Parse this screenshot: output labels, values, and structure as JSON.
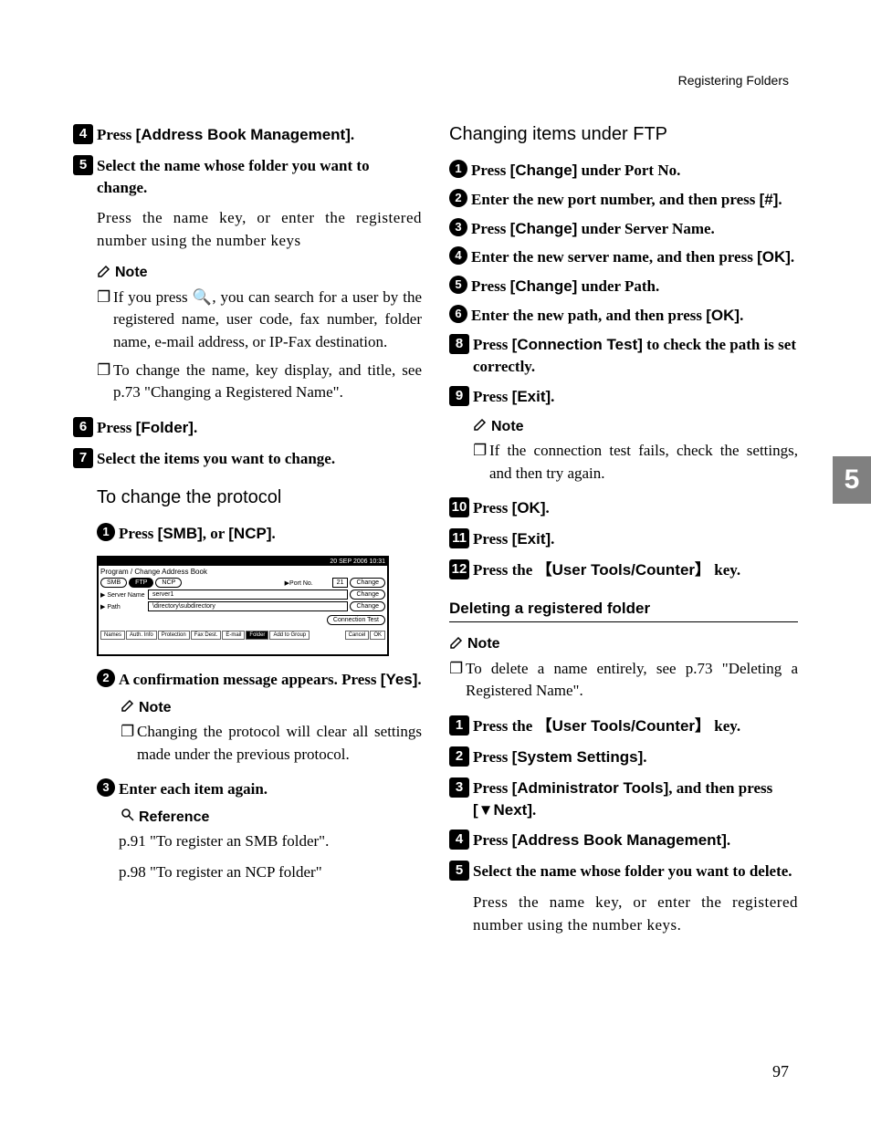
{
  "header": {
    "running_head": "Registering Folders"
  },
  "chapter_tab": "5",
  "page_number": "97",
  "left": {
    "step4": {
      "num": "4",
      "prefix": "Press ",
      "btn": "[Address Book Management]",
      "suffix": "."
    },
    "step5": {
      "num": "5",
      "text": "Select the name whose folder you want to change."
    },
    "step5_desc": "Press the name key, or enter the registered number using the number keys",
    "note_label": "Note",
    "note_items": [
      "If you press 🔍, you can search for a user by the registered name, user code, fax number, folder name, e-mail address, or IP-Fax destination.",
      "To change the name, key display, and title, see p.73 \"Changing a Registered Name\"."
    ],
    "step6": {
      "num": "6",
      "prefix": "Press ",
      "btn": "[Folder]",
      "suffix": "."
    },
    "step7": {
      "num": "7",
      "text": "Select the items you want to change."
    },
    "heading_protocol": "To change the protocol",
    "sub1": {
      "num": "1",
      "prefix": "Press ",
      "btn1": "[SMB]",
      "mid": ", or ",
      "btn2": "[NCP]",
      "suffix": "."
    },
    "screenshot": {
      "title": "Program / Change Address Book",
      "smb": "SMB",
      "ftp": "FTP",
      "ncp": "NCP",
      "portno_label": "▶Port No.",
      "portno_val": "21",
      "change": "Change",
      "server_label": "▶ Server Name",
      "server_val": "server1",
      "path_label": "▶ Path",
      "path_val": "\\directory\\subdirectory",
      "conn_test": "Connection Test",
      "tabs": [
        "Names",
        "Auth. Info",
        "Protection",
        "Fax Dest.",
        "E-mail",
        "Folder",
        "Add to Group"
      ],
      "cancel": "Cancel",
      "ok": "OK"
    },
    "sub2": {
      "num": "2",
      "text_a": "A confirmation message appears. Press ",
      "btn": "[Yes]",
      "suffix": "."
    },
    "sub_note_label": "Note",
    "sub_note_item": "Changing the protocol will clear all settings made under the previous protocol.",
    "sub3": {
      "num": "3",
      "text": "Enter each item again."
    },
    "ref_label": "Reference",
    "ref1": "p.91 \"To register an SMB folder\".",
    "ref2": "p.98 \"To register an NCP folder\""
  },
  "right": {
    "heading_ftp": "Changing items under FTP",
    "f1": {
      "num": "1",
      "prefix": "Press ",
      "btn": "[Change]",
      "suffix": " under Port No."
    },
    "f2": {
      "num": "2",
      "text_a": "Enter the new port number, and then press ",
      "btn": "[#]",
      "suffix": "."
    },
    "f3": {
      "num": "3",
      "prefix": "Press ",
      "btn": "[Change]",
      "suffix": " under Server Name."
    },
    "f4": {
      "num": "4",
      "text_a": "Enter the new server name, and then press ",
      "btn": "[OK]",
      "suffix": "."
    },
    "f5": {
      "num": "5",
      "prefix": "Press ",
      "btn": "[Change]",
      "suffix": " under Path."
    },
    "f6": {
      "num": "6",
      "text_a": "Enter the new path, and then press ",
      "btn": "[OK]",
      "suffix": "."
    },
    "step8": {
      "num": "8",
      "prefix": "Press ",
      "btn": "[Connection Test]",
      "suffix": " to check the path is set correctly."
    },
    "step9": {
      "num": "9",
      "prefix": "Press ",
      "btn": "[Exit]",
      "suffix": "."
    },
    "note9_label": "Note",
    "note9_item": "If the connection test fails, check the settings, and then try again.",
    "step10": {
      "num": "10",
      "prefix": "Press ",
      "btn": "[OK]",
      "suffix": "."
    },
    "step11": {
      "num": "11",
      "prefix": "Press ",
      "btn": "[Exit]",
      "suffix": "."
    },
    "step12": {
      "num": "12",
      "prefix": "Press the ",
      "key_l": "【",
      "key": "User Tools/Counter",
      "key_r": "】",
      "suffix": " key."
    },
    "section_delete": "Deleting a registered folder",
    "del_note_label": "Note",
    "del_note_item": "To delete a name entirely, see p.73 \"Deleting a Registered Name\".",
    "d1": {
      "num": "1",
      "prefix": "Press the ",
      "key_l": "【",
      "key": "User Tools/Counter",
      "key_r": "】",
      "suffix": " key."
    },
    "d2": {
      "num": "2",
      "prefix": "Press ",
      "btn": "[System Settings]",
      "suffix": "."
    },
    "d3": {
      "num": "3",
      "prefix": "Press ",
      "btn": "[Administrator Tools]",
      "mid": ", and then press ",
      "btn2": "[▼Next]",
      "suffix": "."
    },
    "d4": {
      "num": "4",
      "prefix": "Press ",
      "btn": "[Address Book Management]",
      "suffix": "."
    },
    "d5": {
      "num": "5",
      "text": "Select the name whose folder you want to delete."
    },
    "d5_desc": "Press the name key, or enter the registered number using the number keys."
  }
}
